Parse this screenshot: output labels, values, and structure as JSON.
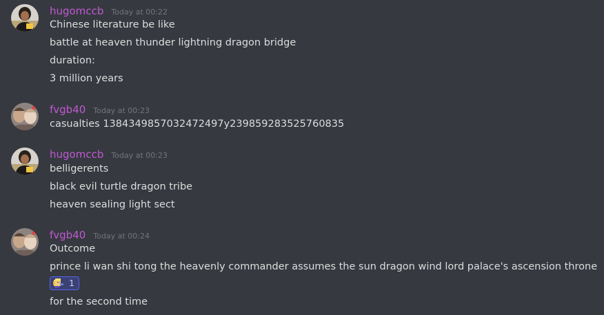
{
  "messages": [
    {
      "author": "hugomccb",
      "timestamp": "Today at 00:22",
      "lines": [
        "Chinese literature be like",
        "battle at heaven thunder lightning dragon bridge",
        "duration:",
        "3 million years"
      ]
    },
    {
      "author": "fvgb40",
      "timestamp": "Today at 00:23",
      "lines": [
        "casualties 1384349857032472497y239859283525760835"
      ]
    },
    {
      "author": "hugomccb",
      "timestamp": "Today at 00:23",
      "lines": [
        "belligerents",
        "black evil turtle dragon tribe",
        "heaven sealing light sect"
      ]
    },
    {
      "author": "fvgb40",
      "timestamp": "Today at 00:24",
      "lines": [
        "Outcome",
        "prince li wan shi tong the heavenly commander assumes the sun dragon wind lord palace's ascension throne",
        "for the second time"
      ],
      "reaction": {
        "emoji_icon": "pixel-character-emoji-icon",
        "count": "1"
      }
    }
  ],
  "colors": {
    "background": "#36393f",
    "username": "#c059d4",
    "text": "#dcddde",
    "timestamp": "#72767d",
    "reaction_bg": "#3b4173",
    "reaction_border": "#5865f2"
  }
}
